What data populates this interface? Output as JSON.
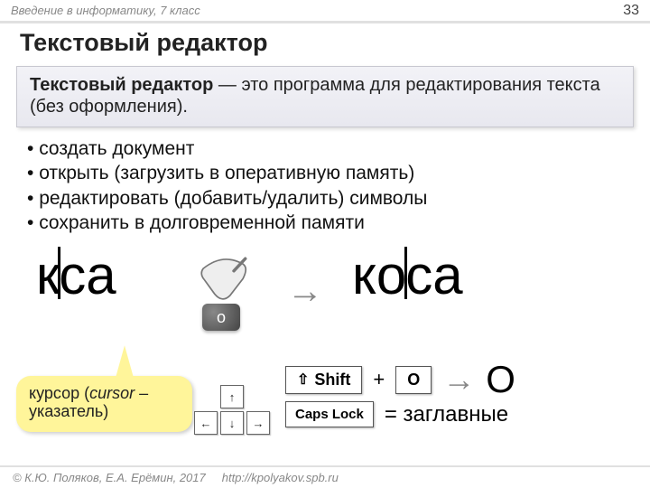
{
  "header": {
    "course": "Введение в информатику, 7 класс",
    "page": "33"
  },
  "title": "Текстовый редактор",
  "definition": {
    "term": "Текстовый редактор",
    "rest": " — это программа для редактирования текста (без оформления)."
  },
  "bullets": [
    "создать документ",
    "открыть (загрузить в оперативную память)",
    "редактировать (добавить/удалить) символы",
    "сохранить в долговременной памяти"
  ],
  "illus": {
    "word1_a": "к",
    "word1_b": "са",
    "word2_a": "ко",
    "word2_b": "са",
    "key_letter": "о"
  },
  "callout": {
    "line1": "курсор (",
    "italic": "cursor",
    "rest": " – указатель)"
  },
  "arrows": {
    "up": "↑",
    "left": "←",
    "down": "↓",
    "right": "→"
  },
  "keys": {
    "shift": "Shift",
    "shift_sym": "⇧",
    "plus": "+",
    "O": "O",
    "bigO": "О",
    "caps": "Caps Lock",
    "caps_eq": "= заглавные"
  },
  "footer": {
    "copy": "© К.Ю. Поляков, Е.А. Ерёмин, 2017",
    "url": "http://kpolyakov.spb.ru"
  }
}
